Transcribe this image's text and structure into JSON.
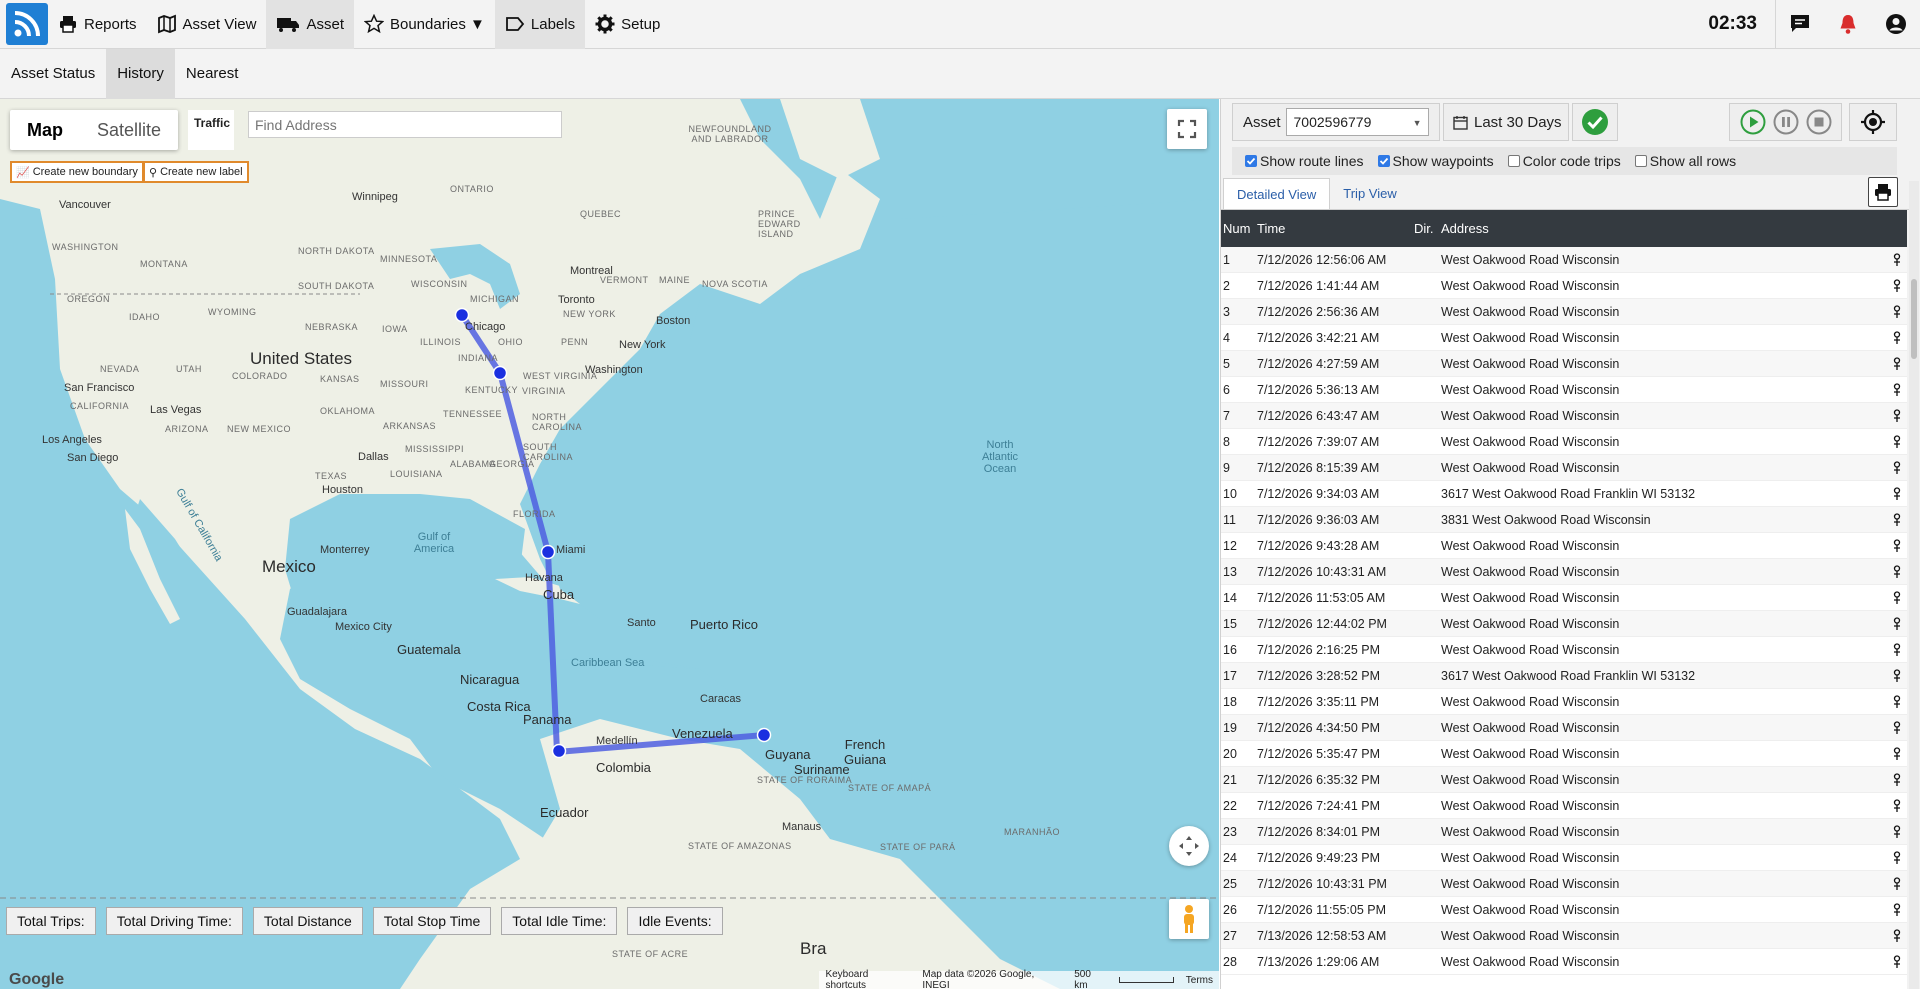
{
  "nav": {
    "items": [
      {
        "label": "Reports",
        "icon": "printer-icon"
      },
      {
        "label": "Asset View",
        "icon": "map-icon"
      },
      {
        "label": "Asset",
        "icon": "truck-icon"
      },
      {
        "label": "Boundaries ▼",
        "icon": "star-icon"
      },
      {
        "label": "Labels",
        "icon": "tag-icon"
      },
      {
        "label": "Setup",
        "icon": "gear-icon"
      }
    ],
    "clock": "02:33"
  },
  "subnav": {
    "tabs": [
      "Asset Status",
      "History",
      "Nearest"
    ]
  },
  "map": {
    "type_map": "Map",
    "type_satellite": "Satellite",
    "traffic": "Traffic",
    "find_placeholder": "Find Address",
    "create_boundary": "Create new boundary",
    "create_label": "Create new label",
    "labels": {
      "winnipeg": "Winnipeg",
      "vancouver": "Vancouver",
      "washington_st": "WASHINGTON",
      "montana": "MONTANA",
      "north_dakota": "NORTH DAKOTA",
      "south_dakota": "SOUTH DAKOTA",
      "oregon": "OREGON",
      "idaho": "IDAHO",
      "wyoming": "WYOMING",
      "nebraska": "NEBRASKA",
      "iowa": "IOWA",
      "minnesota": "MINNESOTA",
      "wisconsin": "WISCONSIN",
      "michigan": "MICHIGAN",
      "us": "United States",
      "nevada": "NEVADA",
      "utah": "UTAH",
      "colorado": "COLORADO",
      "kansas": "KANSAS",
      "missouri": "MISSOURI",
      "illinois": "ILLINOIS",
      "indiana": "INDIANA",
      "ohio": "OHIO",
      "penn": "PENN",
      "new_york_st": "NEW YORK",
      "vermont": "VERMONT",
      "maine": "MAINE",
      "quebec": "QUEBEC",
      "ontario": "ONTARIO",
      "newfoundland": "NEWFOUNDLAND AND LABRADOR",
      "pei": "PRINCE EDWARD ISLAND",
      "nova_scotia": "NOVA SCOTIA",
      "montreal": "Montreal",
      "toronto": "Toronto",
      "boston": "Boston",
      "new_york": "New York",
      "washington": "Washington",
      "chicago": "Chicago",
      "san_francisco": "San Francisco",
      "california": "CALIFORNIA",
      "las_vegas": "Las Vegas",
      "arizona": "ARIZONA",
      "new_mexico": "NEW MEXICO",
      "oklahoma": "OKLAHOMA",
      "arkansas": "ARKANSAS",
      "tennessee": "TENNESSEE",
      "kentucky": "KENTUCKY",
      "virginia": "VIRGINIA",
      "west_virginia": "WEST VIRGINIA",
      "north_carolina": "NORTH CAROLINA",
      "south_carolina": "SOUTH CAROLINA",
      "georgia": "GEORGIA",
      "alabama": "ALABAMA",
      "mississippi": "MISSISSIPPI",
      "louisiana": "LOUISIANA",
      "texas": "TEXAS",
      "los_angeles": "Los Angeles",
      "san_diego": "San Diego",
      "dallas": "Dallas",
      "houston": "Houston",
      "florida": "FLORIDA",
      "miami": "Miami",
      "gulf_of_mexico": "Gulf of America",
      "gulf_of_california": "Gulf of California",
      "mexico": "Mexico",
      "monterrey": "Monterrey",
      "guadalajara": "Guadalajara",
      "mexico_city": "Mexico City",
      "havana": "Havana",
      "cuba": "Cuba",
      "santo": "Santo",
      "puerto_rico": "Puerto Rico",
      "caribbean": "Caribbean Sea",
      "guatemala": "Guatemala",
      "nicaragua": "Nicaragua",
      "costa_rica": "Costa Rica",
      "panama": "Panama",
      "caracas": "Caracas",
      "venezuela": "Venezuela",
      "colombia": "Colombia",
      "medellin": "Medellín",
      "guyana": "Guyana",
      "suriname": "Suriname",
      "french_guiana": "French Guiana",
      "ecuador": "Ecuador",
      "manaus": "Manaus",
      "north_atlantic": "North Atlantic Ocean",
      "brazil": "Bra",
      "roraima": "STATE OF RORAIMA",
      "amapa": "STATE OF AMAPÁ",
      "amazonas": "STATE OF AMAZONAS",
      "para": "STATE OF PARÁ",
      "maranhao": "MARANHÃO",
      "acre": "STATE OF ACRE"
    },
    "totals": [
      "Total Trips:",
      "Total Driving Time:",
      "Total Distance",
      "Total Stop Time",
      "Total Idle Time:",
      "Idle Events:"
    ],
    "attribution": {
      "google": "Google",
      "shortcuts": "Keyboard shortcuts",
      "data": "Map data ©2026 Google, INEGI",
      "scale": "500 km",
      "terms": "Terms"
    }
  },
  "panel": {
    "asset_label": "Asset",
    "asset_value": "7002596779",
    "range_label": "Last 30 Days",
    "options": [
      {
        "label": "Show route lines",
        "checked": true
      },
      {
        "label": "Show waypoints",
        "checked": true
      },
      {
        "label": "Color code trips",
        "checked": false
      },
      {
        "label": "Show all rows",
        "checked": false
      }
    ],
    "tabs": [
      "Detailed View",
      "Trip View"
    ],
    "columns": [
      "Num",
      "Time",
      "Dir.",
      "Address"
    ],
    "rows": [
      [
        "1",
        "7/12/2026 12:56:06 AM",
        "West Oakwood Road Wisconsin"
      ],
      [
        "2",
        "7/12/2026 1:41:44 AM",
        "West Oakwood Road Wisconsin"
      ],
      [
        "3",
        "7/12/2026 2:56:36 AM",
        "West Oakwood Road Wisconsin"
      ],
      [
        "4",
        "7/12/2026 3:42:21 AM",
        "West Oakwood Road Wisconsin"
      ],
      [
        "5",
        "7/12/2026 4:27:59 AM",
        "West Oakwood Road Wisconsin"
      ],
      [
        "6",
        "7/12/2026 5:36:13 AM",
        "West Oakwood Road Wisconsin"
      ],
      [
        "7",
        "7/12/2026 6:43:47 AM",
        "West Oakwood Road Wisconsin"
      ],
      [
        "8",
        "7/12/2026 7:39:07 AM",
        "West Oakwood Road Wisconsin"
      ],
      [
        "9",
        "7/12/2026 8:15:39 AM",
        "West Oakwood Road Wisconsin"
      ],
      [
        "10",
        "7/12/2026 9:34:03 AM",
        "3617 West Oakwood Road Franklin WI 53132"
      ],
      [
        "11",
        "7/12/2026 9:36:03 AM",
        "3831 West Oakwood Road Wisconsin"
      ],
      [
        "12",
        "7/12/2026 9:43:28 AM",
        "West Oakwood Road Wisconsin"
      ],
      [
        "13",
        "7/12/2026 10:43:31 AM",
        "West Oakwood Road Wisconsin"
      ],
      [
        "14",
        "7/12/2026 11:53:05 AM",
        "West Oakwood Road Wisconsin"
      ],
      [
        "15",
        "7/12/2026 12:44:02 PM",
        "West Oakwood Road Wisconsin"
      ],
      [
        "16",
        "7/12/2026 2:16:25 PM",
        "West Oakwood Road Wisconsin"
      ],
      [
        "17",
        "7/12/2026 3:28:52 PM",
        "3617 West Oakwood Road Franklin WI 53132"
      ],
      [
        "18",
        "7/12/2026 3:35:11 PM",
        "West Oakwood Road Wisconsin"
      ],
      [
        "19",
        "7/12/2026 4:34:50 PM",
        "West Oakwood Road Wisconsin"
      ],
      [
        "20",
        "7/12/2026 5:35:47 PM",
        "West Oakwood Road Wisconsin"
      ],
      [
        "21",
        "7/12/2026 6:35:32 PM",
        "West Oakwood Road Wisconsin"
      ],
      [
        "22",
        "7/12/2026 7:24:41 PM",
        "West Oakwood Road Wisconsin"
      ],
      [
        "23",
        "7/12/2026 8:34:01 PM",
        "West Oakwood Road Wisconsin"
      ],
      [
        "24",
        "7/12/2026 9:49:23 PM",
        "West Oakwood Road Wisconsin"
      ],
      [
        "25",
        "7/12/2026 10:43:31 PM",
        "West Oakwood Road Wisconsin"
      ],
      [
        "26",
        "7/12/2026 11:55:05 PM",
        "West Oakwood Road Wisconsin"
      ],
      [
        "27",
        "7/13/2026 12:58:53 AM",
        "West Oakwood Road Wisconsin"
      ],
      [
        "28",
        "7/13/2026 1:29:06 AM",
        "West Oakwood Road Wisconsin"
      ]
    ]
  },
  "colors": {
    "route": "#4f5fe0",
    "waypoint": "#1a2fe0",
    "water": "#8fd0e3",
    "land": "#eef0e6",
    "brand": "#1f7fd4",
    "ok_green": "#2e9e3e",
    "notification_red": "#d92c2c"
  }
}
